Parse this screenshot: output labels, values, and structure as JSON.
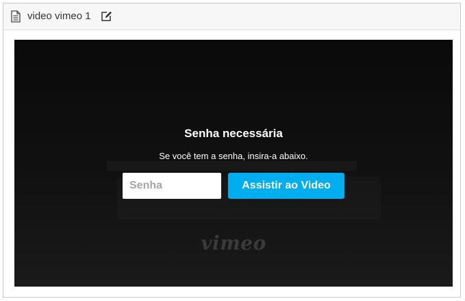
{
  "panel": {
    "title": "video vimeo 1",
    "icons": {
      "document": "document-icon",
      "edit": "edit-icon"
    }
  },
  "video": {
    "overlay_title": "Senha necessária",
    "overlay_subtitle": "Se você tem a senha, insira-a abaixo.",
    "password_placeholder": "Senha",
    "password_value": "",
    "submit_label": "Assistir ao Video",
    "logo_text": "vimeo"
  },
  "colors": {
    "accent": "#00adef",
    "video_background": "#0b0b0b",
    "header_background": "#f7f7f7"
  }
}
